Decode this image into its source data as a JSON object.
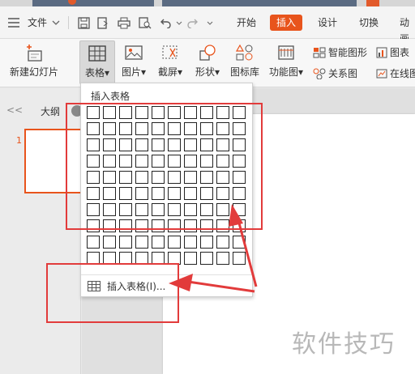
{
  "menubar": {
    "file_label": "文件",
    "tabs": [
      "开始",
      "插入",
      "设计",
      "切换",
      "动画"
    ],
    "active_tab_index": 1,
    "accent_color": "#e8541c"
  },
  "ribbon": {
    "new_slide": "新建幻灯片",
    "table": "表格",
    "picture": "图片",
    "screenshot": "截屏",
    "shape": "形状",
    "icon_lib": "图标库",
    "function_chart": "功能图",
    "smart_art": "智能图形",
    "chart": "图表",
    "relation": "关系图",
    "online": "在线图"
  },
  "leftpane": {
    "collapse_glyph": "<<",
    "outline_label": "大纲",
    "slide_number": "1"
  },
  "dropdown": {
    "title": "插入表格",
    "grid_rows": 10,
    "grid_cols": 10,
    "insert_table_label": "插入表格(I)..."
  },
  "watermark": "软件技巧",
  "annotation_color": "#e23b3b"
}
